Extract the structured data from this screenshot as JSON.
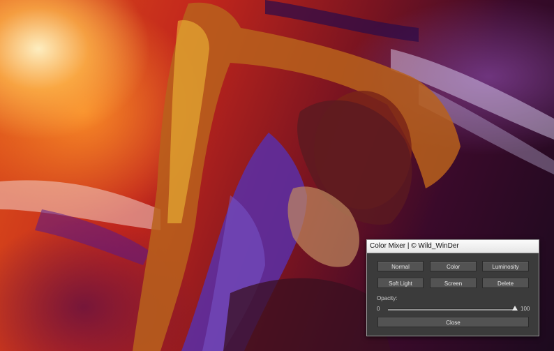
{
  "dialog": {
    "title": "Color Mixer | © Wild_WinDer",
    "buttons": {
      "normal": "Normal",
      "color": "Color",
      "luminosity": "Luminosity",
      "soft_light": "Soft Light",
      "screen": "Screen",
      "delete": "Delete",
      "close": "Close"
    },
    "opacity": {
      "label": "Opacity:",
      "min": "0",
      "max": "100",
      "value": 100
    }
  },
  "colors": {
    "dialog_bg": "#3b3b3b",
    "button_bg": "#535353",
    "button_text": "#e9e9e9",
    "titlebar_bg": "#f0f0f0"
  }
}
